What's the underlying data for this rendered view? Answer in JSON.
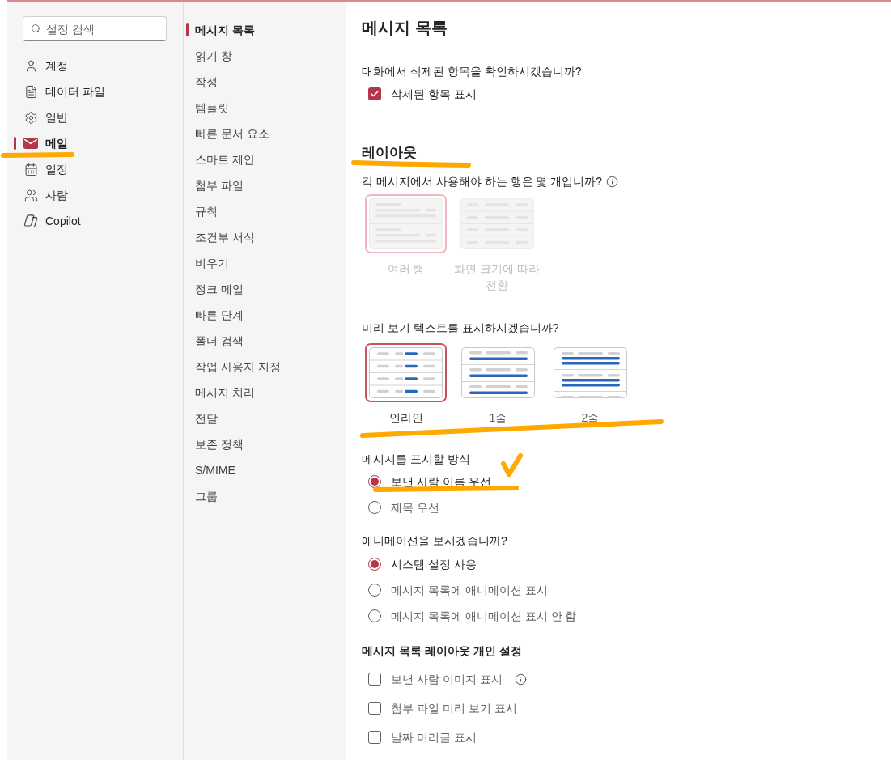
{
  "search": {
    "placeholder": "설정 검색"
  },
  "sidebar": {
    "items": [
      {
        "label": "계정",
        "selected": false
      },
      {
        "label": "데이터 파일",
        "selected": false
      },
      {
        "label": "일반",
        "selected": false
      },
      {
        "label": "메일",
        "selected": true
      },
      {
        "label": "일정",
        "selected": false
      },
      {
        "label": "사람",
        "selected": false
      },
      {
        "label": "Copilot",
        "selected": false
      }
    ]
  },
  "subnav": {
    "items": [
      {
        "label": "메시지 목록",
        "selected": true
      },
      {
        "label": "읽기 창",
        "selected": false
      },
      {
        "label": "작성",
        "selected": false
      },
      {
        "label": "템플릿",
        "selected": false
      },
      {
        "label": "빠른 문서 요소",
        "selected": false
      },
      {
        "label": "스마트 제안",
        "selected": false
      },
      {
        "label": "첨부 파일",
        "selected": false
      },
      {
        "label": "규칙",
        "selected": false
      },
      {
        "label": "조건부 서식",
        "selected": false
      },
      {
        "label": "비우기",
        "selected": false
      },
      {
        "label": "정크 메일",
        "selected": false
      },
      {
        "label": "빠른 단계",
        "selected": false
      },
      {
        "label": "폴더 검색",
        "selected": false
      },
      {
        "label": "작업 사용자 지정",
        "selected": false
      },
      {
        "label": "메시지 처리",
        "selected": false
      },
      {
        "label": "전달",
        "selected": false
      },
      {
        "label": "보존 정책",
        "selected": false
      },
      {
        "label": "S/MIME",
        "selected": false
      },
      {
        "label": "그룹",
        "selected": false
      }
    ]
  },
  "page": {
    "title": "메시지 목록"
  },
  "deleted_items": {
    "question": "대화에서 삭제된 항목을 확인하시겠습니까?",
    "option": {
      "label": "삭제된 항목 표시",
      "checked": true
    }
  },
  "layout": {
    "heading": "레이아웃",
    "rows": {
      "question": "각 메시지에서 사용해야 하는 행은 몇 개입니까?",
      "info": true,
      "disabled": true,
      "options": [
        {
          "kind": "multi",
          "label": "여러 행",
          "selected": true
        },
        {
          "kind": "adaptive",
          "label": "화면 크기에 따라 전환",
          "selected": false
        }
      ]
    },
    "preview": {
      "question": "미리 보기 텍스트를 표시하시겠습니까?",
      "options": [
        {
          "kind": "inline",
          "label": "인라인",
          "selected": true
        },
        {
          "kind": "single",
          "label": "1줄",
          "selected": false
        },
        {
          "kind": "double",
          "label": "2줄",
          "selected": false
        }
      ]
    }
  },
  "display_mode": {
    "question": "메시지를 표시할 방식",
    "options": [
      {
        "label": "보낸 사람 이름 우선",
        "selected": true
      },
      {
        "label": "제목 우선",
        "selected": false
      }
    ]
  },
  "animation": {
    "question": "애니메이션을 보시겠습니까?",
    "options": [
      {
        "label": "시스템 설정 사용",
        "selected": true
      },
      {
        "label": "메시지 목록에 애니메이션 표시",
        "selected": false
      },
      {
        "label": "메시지 목록에 애니메이션 표시 안 함",
        "selected": false
      }
    ]
  },
  "personal": {
    "heading": "메시지 목록 레이아웃 개인 설정",
    "options": [
      {
        "label": "보낸 사람 이미지 표시",
        "checked": false,
        "info": true
      },
      {
        "label": "첨부 파일 미리 보기 표시",
        "checked": false
      },
      {
        "label": "날짜 머리글 표시",
        "checked": false
      }
    ]
  }
}
